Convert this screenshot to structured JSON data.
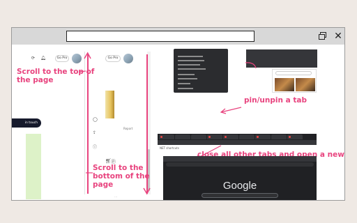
{
  "annotations": {
    "scroll_top": "Scroll to the top of the page",
    "scroll_bottom": "Scroll to the bottom of the page",
    "pin_unpin": "pin/unpin a tab",
    "close_others": "close all other tabs and open a new tab"
  },
  "mock": {
    "go_pro_1": "Go Pro",
    "go_pro_2": "Go Pro",
    "in_touch": "in touch",
    "report": "Report",
    "google": "Google",
    "shortcuts": "NET shortcuts"
  },
  "colors": {
    "annotation": "#e8437e",
    "dark_ui": "#202124"
  }
}
